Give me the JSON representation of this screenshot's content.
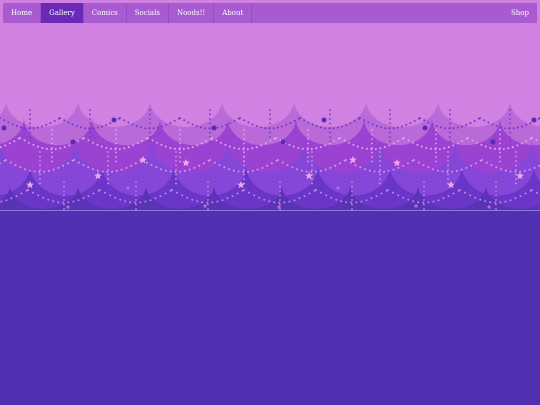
{
  "nav": {
    "items": [
      {
        "label": "Home",
        "active": false
      },
      {
        "label": "Gallery",
        "active": true
      },
      {
        "label": "Comics",
        "active": false
      },
      {
        "label": "Socials",
        "active": false
      },
      {
        "label": "Noods!!",
        "active": false
      },
      {
        "label": "About",
        "active": false
      }
    ],
    "shop_label": "Shop"
  },
  "colors": {
    "sky": "#d081e2",
    "wave1": "#b96ad8",
    "wave2": "#9c42d2",
    "wave3": "#8646d8",
    "wave4": "#6a36c8",
    "page_bg": "#5130b2",
    "nav_bg": "#a85ad0",
    "nav_active": "#6a2ab8",
    "bead": "#7b4ed0",
    "star": "#f0a6ee"
  }
}
